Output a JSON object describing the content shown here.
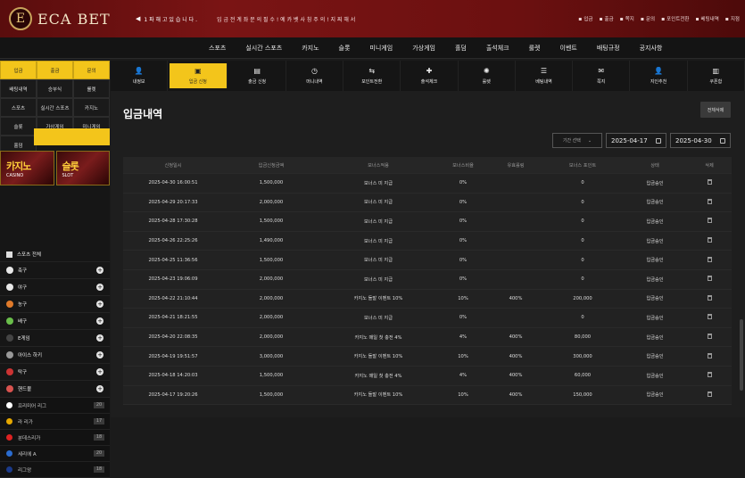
{
  "header": {
    "logo_letter": "E",
    "logo_text": "ECA BET",
    "notice_title": "1 파 해 고 있 습 니 다 .",
    "notice_text": "입 금 전 계 좌 문 의 필 수 ! 예 카 벳 사 칭 주 의 ! 지 찌 해 서",
    "links": [
      "입금",
      "출금",
      "쪽지",
      "문의",
      "포인트전환",
      "베팅내역",
      "지점"
    ]
  },
  "main_nav": [
    "스포츠",
    "실시간 스포츠",
    "카지노",
    "슬롯",
    "미니게임",
    "가상게임",
    "홀덤",
    "출석체크",
    "룰렛",
    "이벤트",
    "배팅규정",
    "공지사항"
  ],
  "sidebar": {
    "grid": [
      {
        "label": "입금",
        "style": "y"
      },
      {
        "label": "출금",
        "style": "y"
      },
      {
        "label": "문의",
        "style": "y"
      },
      {
        "label": "배팅내역",
        "style": ""
      },
      {
        "label": "승부식",
        "style": ""
      },
      {
        "label": "룰렛",
        "style": ""
      },
      {
        "label": "스포츠",
        "style": ""
      },
      {
        "label": "실시간 스포츠",
        "style": ""
      },
      {
        "label": "카지노",
        "style": ""
      },
      {
        "label": "슬롯",
        "style": ""
      },
      {
        "label": "가상게임",
        "style": ""
      },
      {
        "label": "미니게임",
        "style": ""
      },
      {
        "label": "홀덤",
        "style": ""
      }
    ],
    "banners": [
      {
        "big": "카지노",
        "small": "CASINO"
      },
      {
        "big": "슬롯",
        "small": "SLOT"
      }
    ],
    "sports_all_label": "스포츠 전체",
    "sports": [
      {
        "label": "축구",
        "color": "#e8e8e8"
      },
      {
        "label": "야구",
        "color": "#e8e8e8"
      },
      {
        "label": "농구",
        "color": "#e07a2a"
      },
      {
        "label": "배구",
        "color": "#6abf4b"
      },
      {
        "label": "E게임",
        "color": "#444444"
      },
      {
        "label": "아이스 하키",
        "color": "#999999"
      },
      {
        "label": "탁구",
        "color": "#cc3333"
      },
      {
        "label": "핸드볼",
        "color": "#d9534f"
      }
    ],
    "leagues": [
      {
        "label": "프리미어 리그",
        "count": "20",
        "color": "#ffffff"
      },
      {
        "label": "라 리가",
        "count": "17",
        "color": "#e6a800"
      },
      {
        "label": "분데스리가",
        "count": "18",
        "color": "#d22"
      },
      {
        "label": "세리에 A",
        "count": "20",
        "color": "#2a6cd0"
      },
      {
        "label": "리그앙",
        "count": "18",
        "color": "#1b3a8a"
      }
    ]
  },
  "tabs": [
    {
      "label": "내정보",
      "icon": "👤",
      "active": false
    },
    {
      "label": "입금 신청",
      "icon": "▣",
      "active": true
    },
    {
      "label": "출금 신청",
      "icon": "▤",
      "active": false
    },
    {
      "label": "머니내역",
      "icon": "◷",
      "active": false
    },
    {
      "label": "포인트전환",
      "icon": "⇆",
      "active": false
    },
    {
      "label": "출석체크",
      "icon": "✚",
      "active": false
    },
    {
      "label": "룰렛",
      "icon": "✺",
      "active": false
    },
    {
      "label": "베팅내역",
      "icon": "☰",
      "active": false
    },
    {
      "label": "쪽지",
      "icon": "✉",
      "active": false
    },
    {
      "label": "지인추천",
      "icon": "👤",
      "active": false
    },
    {
      "label": "쿠폰함",
      "icon": "▥",
      "active": false
    }
  ],
  "page": {
    "title": "입금내역",
    "detail_button": "전체삭제",
    "period_select": "기간 선택",
    "date_from": "2025-04-17",
    "date_to": "2025-04-30"
  },
  "table": {
    "headers": [
      "신청일시",
      "입금신청금액",
      "보너스적용",
      "보너스비율",
      "유효롤링",
      "보너스 포인트",
      "상태",
      "삭제"
    ],
    "rows": [
      [
        "2025-04-30 16:00:51",
        "1,500,000",
        "보너스 미 지급",
        "0%",
        "",
        "0",
        "입금승인"
      ],
      [
        "2025-04-29 20:17:33",
        "2,000,000",
        "보너스 미 지급",
        "0%",
        "",
        "0",
        "입금승인"
      ],
      [
        "2025-04-28 17:30:28",
        "1,500,000",
        "보너스 미 지급",
        "0%",
        "",
        "0",
        "입금승인"
      ],
      [
        "2025-04-26 22:25:26",
        "1,490,000",
        "보너스 미 지급",
        "0%",
        "",
        "0",
        "입금승인"
      ],
      [
        "2025-04-25 11:36:56",
        "1,500,000",
        "보너스 미 지급",
        "0%",
        "",
        "0",
        "입금승인"
      ],
      [
        "2025-04-23 19:06:09",
        "2,000,000",
        "보너스 미 지급",
        "0%",
        "",
        "0",
        "입금승인"
      ],
      [
        "2025-04-22 21:10:44",
        "2,000,000",
        "카지노 돌발 이벤트 10%",
        "10%",
        "400%",
        "200,000",
        "입금승인"
      ],
      [
        "2025-04-21 18:21:55",
        "2,000,000",
        "보너스 미 지급",
        "0%",
        "",
        "0",
        "입금승인"
      ],
      [
        "2025-04-20 22:08:35",
        "2,000,000",
        "카지노 매일 첫 충전 4%",
        "4%",
        "400%",
        "80,000",
        "입금승인"
      ],
      [
        "2025-04-19 19:51:57",
        "3,000,000",
        "카지노 돌발 이벤트 10%",
        "10%",
        "400%",
        "300,000",
        "입금승인"
      ],
      [
        "2025-04-18 14:20:03",
        "1,500,000",
        "카지노 매일 첫 충전 4%",
        "4%",
        "400%",
        "60,000",
        "입금승인"
      ],
      [
        "2025-04-17 19:20:26",
        "1,500,000",
        "카지노 돌발 이벤트 10%",
        "10%",
        "400%",
        "150,000",
        "입금승인"
      ]
    ]
  }
}
